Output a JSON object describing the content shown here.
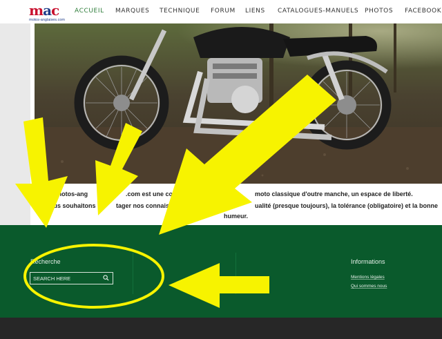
{
  "logo": {
    "letters": [
      "m",
      "a",
      "c"
    ],
    "subtitle": "motos-anglaises.com"
  },
  "nav": {
    "items": [
      {
        "label": "ACCUEIL",
        "active": true
      },
      {
        "label": "MARQUES"
      },
      {
        "label": "TECHNIQUE"
      },
      {
        "label": "FORUM"
      },
      {
        "label": "LIENS"
      },
      {
        "label": "CATALOGUES-MANUELS"
      },
      {
        "label": "PHOTOS"
      },
      {
        "label": "FACEBOOK"
      }
    ]
  },
  "intro": {
    "line1a": "w.motos-ang",
    "line1b": ".com est une coopé",
    "line1c": "moto classique d'outre manche, un espace de liberté.",
    "line2a": "ous souhaitons",
    "line2b": "tager nos connaissa",
    "line2c": "ualité (presque toujours), la tolérance (obligatoire) et la bonne",
    "line3": "humeur."
  },
  "footer": {
    "search_title": "Recherche",
    "search_placeholder": "SEARCH HERE",
    "info_title": "Informations",
    "links": [
      "Mentions légales",
      "Qui sommes nous"
    ]
  },
  "colors": {
    "accent": "#2e7d3a",
    "footer_bg": "#0a5a2c",
    "annotation": "#f7f300",
    "bottom_bar": "#272727"
  },
  "icons": {
    "search": "magnifier-icon"
  }
}
